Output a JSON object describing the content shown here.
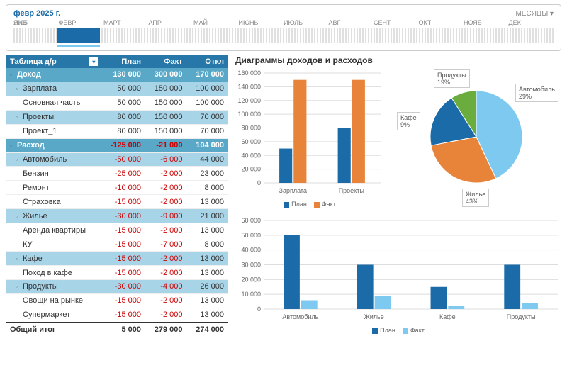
{
  "timeline": {
    "date": "февр 2025 г.",
    "year": "2025",
    "months_button": "МЕСЯЦЫ",
    "months": [
      "ЯНВ",
      "ФЕВР",
      "МАРТ",
      "АПР",
      "МАЙ",
      "ИЮНЬ",
      "ИЮЛЬ",
      "АВГ",
      "СЕНТ",
      "ОКТ",
      "НОЯБ",
      "ДЕК"
    ]
  },
  "table": {
    "headers": [
      "Таблица д/р",
      "План",
      "Факт",
      "Откл"
    ],
    "rows": [
      {
        "t": "cat",
        "cells": [
          "Доход",
          "130 000",
          "300 000",
          "170 000"
        ]
      },
      {
        "t": "sub",
        "cells": [
          "Зарплата",
          "50 000",
          "150 000",
          "100 000"
        ]
      },
      {
        "t": "leaf",
        "cells": [
          "Основная часть",
          "50 000",
          "150 000",
          "100 000"
        ]
      },
      {
        "t": "sub",
        "cells": [
          "Проекты",
          "80 000",
          "150 000",
          "70 000"
        ]
      },
      {
        "t": "leaf",
        "cells": [
          "Проект_1",
          "80 000",
          "150 000",
          "70 000"
        ]
      },
      {
        "t": "cat",
        "cells": [
          "Расход",
          "-125 000",
          "-21 000",
          "104 000"
        ],
        "neg": [
          1,
          2
        ]
      },
      {
        "t": "sub",
        "cells": [
          "Автомобиль",
          "-50 000",
          "-6 000",
          "44 000"
        ],
        "neg": [
          1,
          2
        ]
      },
      {
        "t": "leaf",
        "cells": [
          "Бензин",
          "-25 000",
          "-2 000",
          "23 000"
        ],
        "neg": [
          1,
          2
        ]
      },
      {
        "t": "leaf",
        "cells": [
          "Ремонт",
          "-10 000",
          "-2 000",
          "8 000"
        ],
        "neg": [
          1,
          2
        ]
      },
      {
        "t": "leaf",
        "cells": [
          "Страховка",
          "-15 000",
          "-2 000",
          "13 000"
        ],
        "neg": [
          1,
          2
        ]
      },
      {
        "t": "sub",
        "cells": [
          "Жилье",
          "-30 000",
          "-9 000",
          "21 000"
        ],
        "neg": [
          1,
          2
        ]
      },
      {
        "t": "leaf",
        "cells": [
          "Аренда квартиры",
          "-15 000",
          "-2 000",
          "13 000"
        ],
        "neg": [
          1,
          2
        ]
      },
      {
        "t": "leaf",
        "cells": [
          "КУ",
          "-15 000",
          "-7 000",
          "8 000"
        ],
        "neg": [
          1,
          2
        ]
      },
      {
        "t": "sub",
        "cells": [
          "Кафе",
          "-15 000",
          "-2 000",
          "13 000"
        ],
        "neg": [
          1,
          2
        ]
      },
      {
        "t": "leaf",
        "cells": [
          "Поход в кафе",
          "-15 000",
          "-2 000",
          "13 000"
        ],
        "neg": [
          1,
          2
        ]
      },
      {
        "t": "sub",
        "cells": [
          "Продукты",
          "-30 000",
          "-4 000",
          "26 000"
        ],
        "neg": [
          1,
          2
        ]
      },
      {
        "t": "leaf",
        "cells": [
          "Овощи на рынке",
          "-15 000",
          "-2 000",
          "13 000"
        ],
        "neg": [
          1,
          2
        ]
      },
      {
        "t": "leaf",
        "cells": [
          "Супермаркет",
          "-15 000",
          "-2 000",
          "13 000"
        ],
        "neg": [
          1,
          2
        ]
      },
      {
        "t": "total",
        "cells": [
          "Общий итог",
          "5 000",
          "279 000",
          "274 000"
        ]
      }
    ]
  },
  "charts_title": "Диаграммы доходов и расходов",
  "legend": {
    "plan": "План",
    "fact": "Факт"
  },
  "colors": {
    "plan": "#1a6ba8",
    "fact": "#e8833a",
    "green": "#6aac3e",
    "lightblue": "#7ec9f0"
  },
  "chart_data": [
    {
      "type": "bar",
      "id": "income-bar",
      "title": "",
      "categories": [
        "Зарплата",
        "Проекты"
      ],
      "series": [
        {
          "name": "План",
          "values": [
            50000,
            80000
          ]
        },
        {
          "name": "Факт",
          "values": [
            150000,
            150000
          ]
        }
      ],
      "ylim": [
        0,
        160000
      ],
      "yticks": [
        0,
        20000,
        40000,
        60000,
        80000,
        100000,
        120000,
        140000,
        160000
      ]
    },
    {
      "type": "pie",
      "id": "expense-pie",
      "title": "",
      "slices": [
        {
          "name": "Жилье",
          "pct": 43,
          "color": "#7ec9f0"
        },
        {
          "name": "Автомобиль",
          "pct": 29,
          "color": "#e8833a"
        },
        {
          "name": "Продукты",
          "pct": 19,
          "color": "#1a6ba8"
        },
        {
          "name": "Кафе",
          "pct": 9,
          "color": "#6aac3e"
        }
      ]
    },
    {
      "type": "bar",
      "id": "expense-bar",
      "title": "",
      "categories": [
        "Автомобиль",
        "Жилье",
        "Кафе",
        "Продукты"
      ],
      "series": [
        {
          "name": "План",
          "values": [
            50000,
            30000,
            15000,
            30000
          ]
        },
        {
          "name": "Факт",
          "values": [
            6000,
            9000,
            2000,
            4000
          ]
        }
      ],
      "ylim": [
        0,
        60000
      ],
      "yticks": [
        0,
        10000,
        20000,
        30000,
        40000,
        50000,
        60000
      ]
    }
  ]
}
